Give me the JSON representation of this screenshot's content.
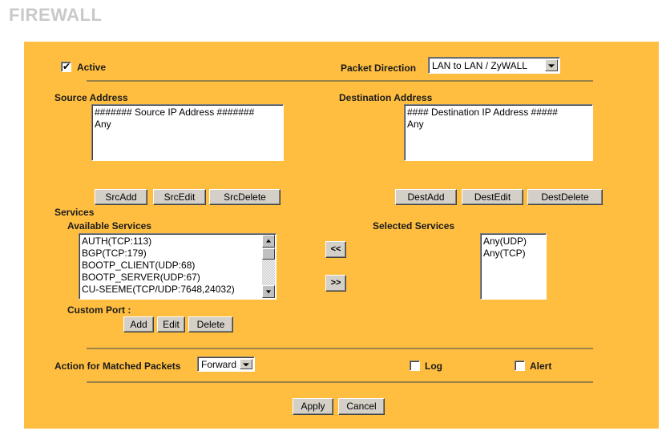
{
  "page": {
    "title": "FIREWALL",
    "panel_color": "#ffbe40",
    "label_color": "#1a1a1a",
    "title_color": "#c9c9c9"
  },
  "top_row": {
    "active_label": "Active",
    "active_checked": true,
    "active_check_glyph": "✔",
    "packet_direction_label": "Packet Direction",
    "packet_direction_value": "LAN to LAN / ZyWALL"
  },
  "source": {
    "heading": "Source Address",
    "items": [
      "####### Source IP Address #######",
      "Any"
    ],
    "buttons": [
      "SrcAdd",
      "SrcEdit",
      "SrcDelete"
    ]
  },
  "destination": {
    "heading": "Destination Address",
    "items": [
      "#### Destination IP Address #####",
      "Any"
    ],
    "buttons": [
      "DestAdd",
      "DestEdit",
      "DestDelete"
    ]
  },
  "services": {
    "heading": "Services",
    "available_label": "Available Services",
    "available_items": [
      "AUTH(TCP:113)",
      "BGP(TCP:179)",
      "BOOTP_CLIENT(UDP:68)",
      "BOOTP_SERVER(UDP:67)",
      "CU-SEEME(TCP/UDP:7648,24032)"
    ],
    "selected_label": "Selected Services",
    "selected_items": [
      "Any(UDP)",
      "Any(TCP)"
    ],
    "move_left_label": "<<",
    "move_right_label": ">>",
    "custom_port_label": "Custom Port :",
    "custom_port_buttons": [
      "Add",
      "Edit",
      "Delete"
    ]
  },
  "action": {
    "label": "Action for Matched Packets",
    "value": "Forward",
    "log_label": "Log",
    "log_checked": false,
    "alert_label": "Alert",
    "alert_checked": false
  },
  "footer": {
    "apply_label": "Apply",
    "cancel_label": "Cancel"
  }
}
